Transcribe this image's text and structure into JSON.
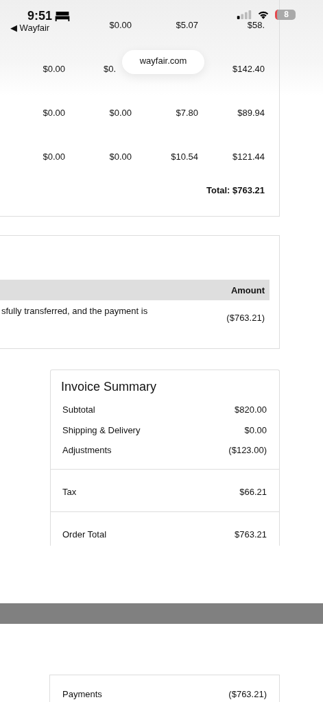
{
  "status_bar": {
    "time": "9:51",
    "back_link": "◀ Wayfair",
    "battery": "8"
  },
  "url_pill": "wayfair.com",
  "line_items": {
    "rows": [
      [
        null,
        "$0.00",
        "$5.07",
        "$58."
      ],
      [
        "$0.00",
        "$0.",
        null,
        "$142.40"
      ],
      [
        "$0.00",
        "$0.00",
        "$7.80",
        "$89.94"
      ],
      [
        "$0.00",
        "$0.00",
        "$10.54",
        "$121.44"
      ]
    ],
    "total": "Total: $763.21"
  },
  "payments_table": {
    "columns": [
      "Amount"
    ],
    "rows": [
      {
        "description": "sfully transferred, and the payment is",
        "amount": "($763.21)"
      }
    ]
  },
  "invoice_summary": {
    "title": "Invoice Summary",
    "groups": [
      [
        {
          "label": "Subtotal",
          "value": "$820.00"
        },
        {
          "label": "Shipping & Delivery",
          "value": "$0.00"
        },
        {
          "label": "Adjustments",
          "value": "($123.00)"
        }
      ],
      [
        {
          "label": "Tax",
          "value": "$66.21"
        }
      ],
      [
        {
          "label": "Order Total",
          "value": "$763.21"
        }
      ]
    ]
  },
  "payments_summary": [
    {
      "label": "Payments",
      "value": "($763.21)"
    }
  ]
}
